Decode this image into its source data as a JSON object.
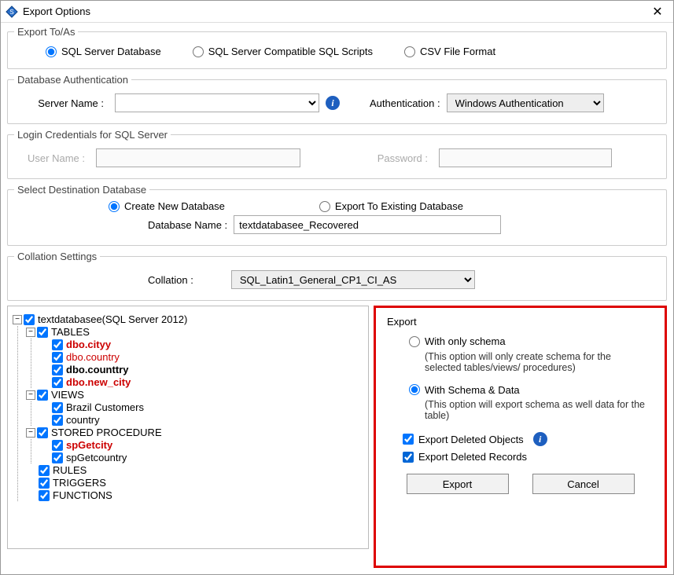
{
  "title": "Export Options",
  "exportToAs": {
    "legend": "Export To/As",
    "sqlServerDb": "SQL Server Database",
    "sqlScripts": "SQL Server Compatible SQL Scripts",
    "csv": "CSV File Format"
  },
  "dbAuth": {
    "legend": "Database Authentication",
    "serverNameLabel": "Server Name :",
    "serverName": "",
    "authLabel": "Authentication :",
    "authValue": "Windows Authentication"
  },
  "loginCreds": {
    "legend": "Login Credentials for SQL Server",
    "userNameLabel": "User Name :",
    "passwordLabel": "Password :"
  },
  "destDb": {
    "legend": "Select Destination Database",
    "createNew": "Create New Database",
    "exportExisting": "Export To Existing Database",
    "dbNameLabel": "Database Name :",
    "dbName": "textdatabasee_Recovered"
  },
  "collation": {
    "legend": "Collation Settings",
    "label": "Collation :",
    "value": "SQL_Latin1_General_CP1_CI_AS"
  },
  "tree": {
    "root": "textdatabasee(SQL Server 2012)",
    "tables": "TABLES",
    "tableItems": [
      "dbo.cityy",
      "dbo.country",
      "dbo.counttry",
      "dbo.new_city"
    ],
    "views": "VIEWS",
    "viewItems": [
      "Brazil Customers",
      "country"
    ],
    "sp": "STORED PROCEDURE",
    "spItems": [
      "spGetcity",
      "spGetcountry"
    ],
    "rules": "RULES",
    "triggers": "TRIGGERS",
    "functions": "FUNCTIONS"
  },
  "export": {
    "legend": "Export",
    "onlySchema": "With only schema",
    "onlySchemaDesc": "(This option will only create schema for the  selected tables/views/ procedures)",
    "schemaData": "With Schema & Data",
    "schemaDataDesc": "(This option will export schema as well data for the table)",
    "deletedObjects": "Export Deleted Objects",
    "deletedRecords": "Export Deleted Records",
    "exportBtn": "Export",
    "cancelBtn": "Cancel"
  }
}
